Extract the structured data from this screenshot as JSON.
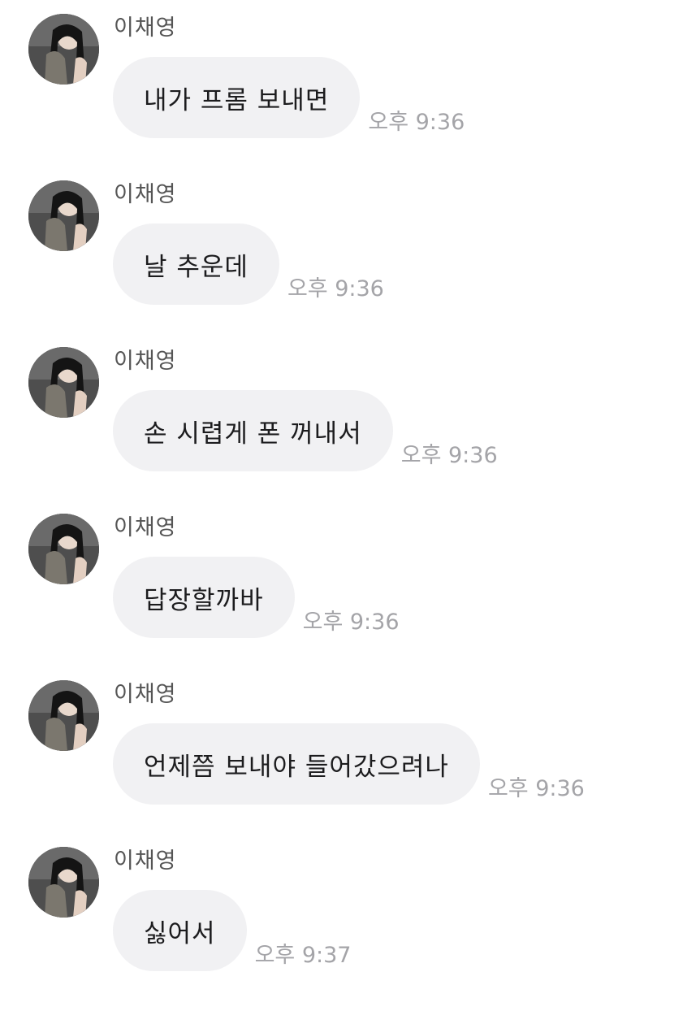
{
  "chat": {
    "messages": [
      {
        "sender": "이채영",
        "text": "내가 프롬 보내면",
        "time": "오후 9:36"
      },
      {
        "sender": "이채영",
        "text": "날 추운데",
        "time": "오후 9:36"
      },
      {
        "sender": "이채영",
        "text": "손 시렵게 폰 꺼내서",
        "time": "오후 9:36"
      },
      {
        "sender": "이채영",
        "text": "답장할까바",
        "time": "오후 9:36"
      },
      {
        "sender": "이채영",
        "text": "언제쯤 보내야 들어갔으려나",
        "time": "오후 9:36"
      },
      {
        "sender": "이채영",
        "text": "싫어서",
        "time": "오후 9:37"
      }
    ]
  },
  "colors": {
    "bubble_background": "#f1f1f3",
    "message_text": "#1c1c1e",
    "sender_text": "#555555",
    "timestamp_text": "#a4a4a8"
  }
}
